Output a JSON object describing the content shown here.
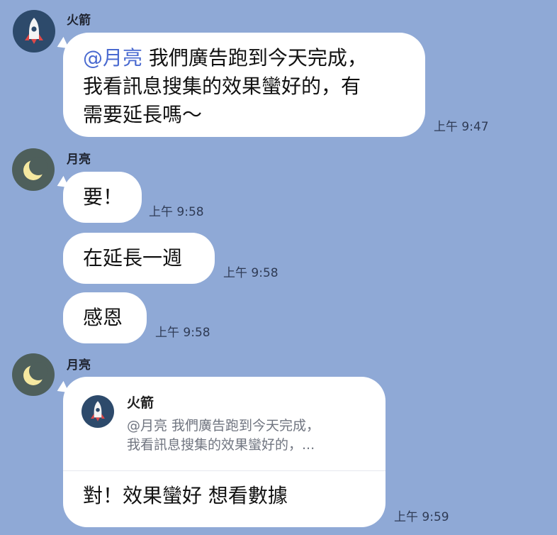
{
  "messages": [
    {
      "sender": "火箭",
      "mention": "@月亮",
      "line1": " 我們廣告跑到今天完成，",
      "line2": "我看訊息搜集的效果蠻好的，有",
      "line3": "需要延長嗎～",
      "time": "上午 9:47"
    },
    {
      "sender": "月亮",
      "text": "要！",
      "time": "上午 9:58"
    },
    {
      "text": "在延長一週",
      "time": "上午 9:58"
    },
    {
      "text": "感恩",
      "time": "上午 9:58"
    },
    {
      "sender": "月亮",
      "quote": {
        "name": "火箭",
        "line1": "@月亮 我們廣告跑到今天完成，",
        "line2": "我看訊息搜集的效果蠻好的，..."
      },
      "text": "對！效果蠻好 想看數據",
      "time": "上午 9:59"
    }
  ]
}
